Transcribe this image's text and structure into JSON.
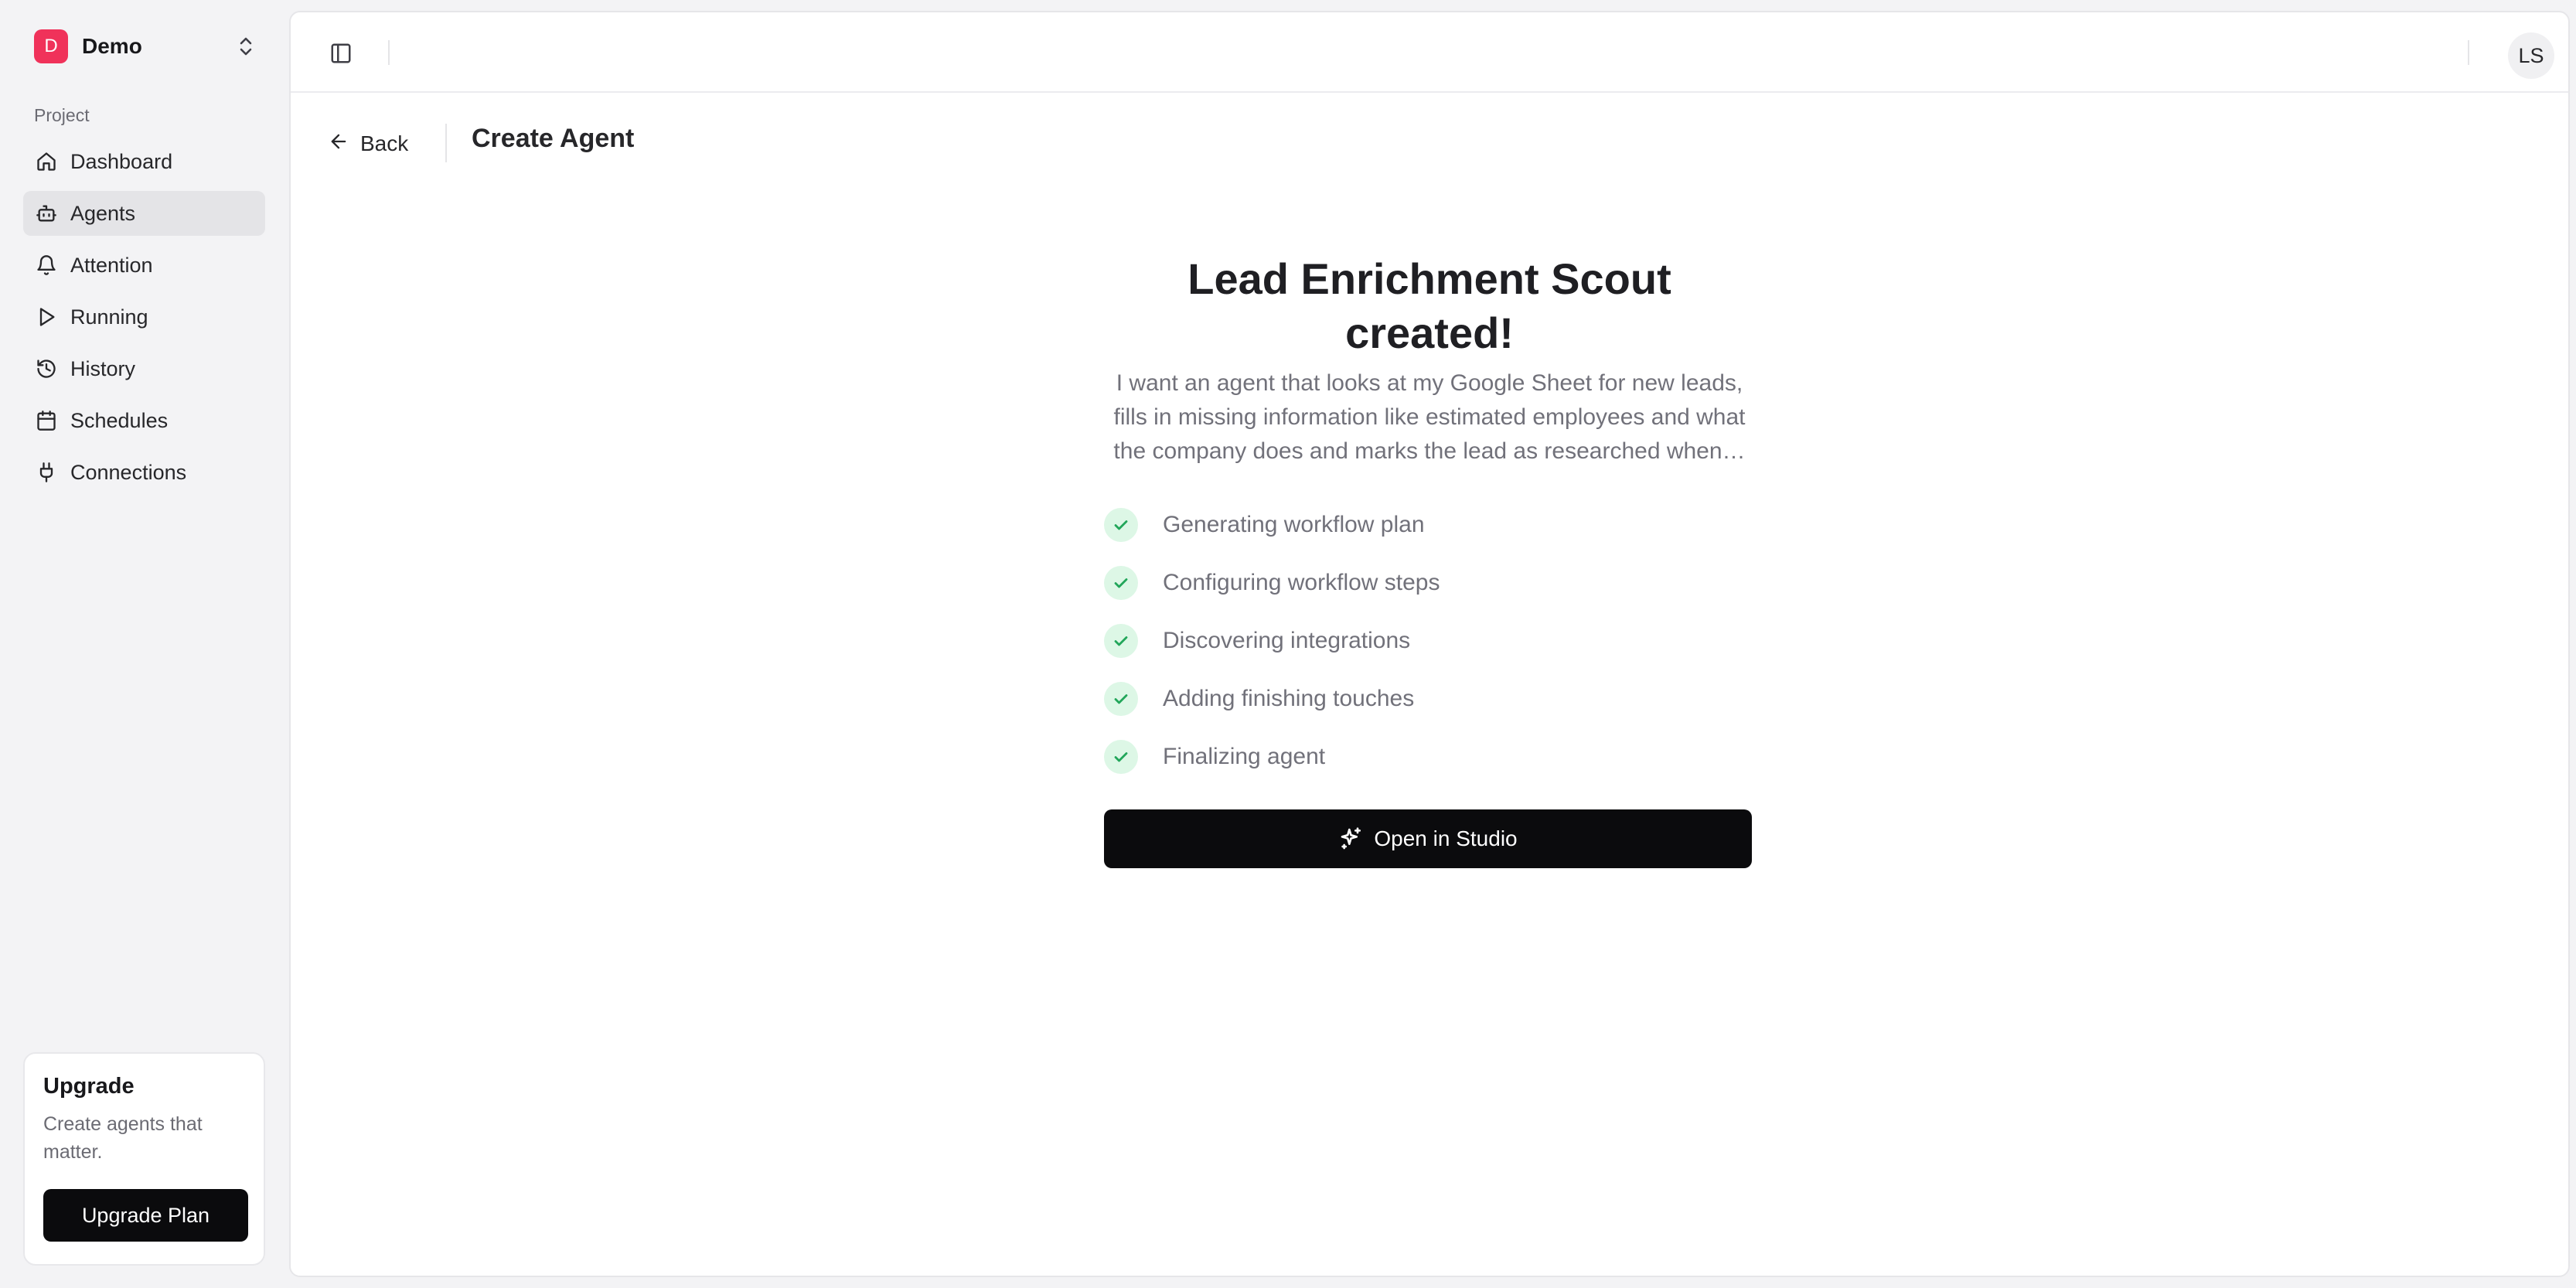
{
  "org": {
    "initial": "D",
    "name": "Demo"
  },
  "sidebar": {
    "section_label": "Project",
    "items": [
      {
        "label": "Dashboard",
        "icon": "home-icon",
        "active": false
      },
      {
        "label": "Agents",
        "icon": "bot-icon",
        "active": true
      },
      {
        "label": "Attention",
        "icon": "bell-icon",
        "active": false
      },
      {
        "label": "Running",
        "icon": "play-icon",
        "active": false
      },
      {
        "label": "History",
        "icon": "history-icon",
        "active": false
      },
      {
        "label": "Schedules",
        "icon": "calendar-icon",
        "active": false
      },
      {
        "label": "Connections",
        "icon": "plug-icon",
        "active": false
      }
    ],
    "upgrade": {
      "title": "Upgrade",
      "description": "Create agents that matter.",
      "button_label": "Upgrade Plan"
    }
  },
  "topbar": {
    "avatar_initials": "LS"
  },
  "subheader": {
    "back_label": "Back",
    "page_title": "Create Agent"
  },
  "main": {
    "title": "Lead Enrichment Scout created!",
    "description_lines": [
      "I want an agent that looks at my Google Sheet for new leads,",
      "fills in missing information like estimated employees and what",
      "the company does and marks the lead as researched when…"
    ],
    "steps": [
      {
        "label": "Generating workflow plan",
        "status": "done"
      },
      {
        "label": "Configuring workflow steps",
        "status": "done"
      },
      {
        "label": "Discovering integrations",
        "status": "done"
      },
      {
        "label": "Adding finishing touches",
        "status": "done"
      },
      {
        "label": "Finalizing agent",
        "status": "done"
      }
    ],
    "cta_label": "Open in Studio"
  },
  "colors": {
    "brand_badge": "#f0325a",
    "check_bg": "#ddf7e6",
    "check_icon": "#22a65a",
    "primary_button": "#0b0b0d",
    "active_nav_bg": "#e4e4e7"
  }
}
